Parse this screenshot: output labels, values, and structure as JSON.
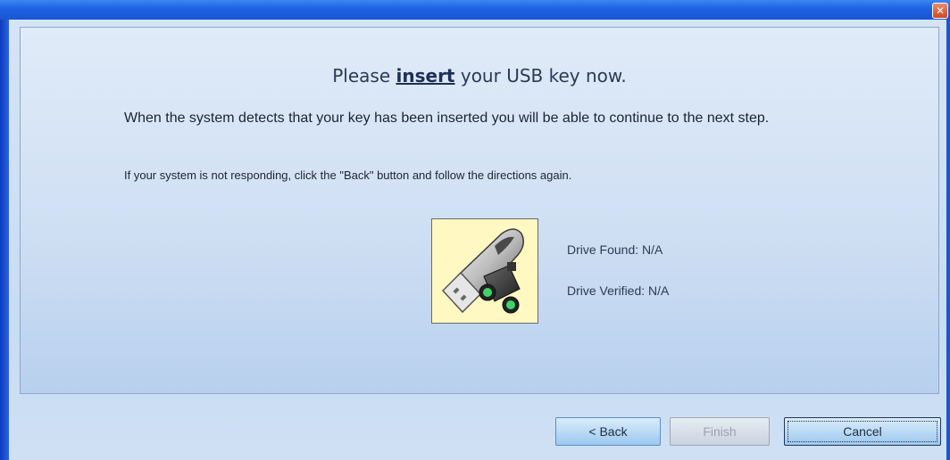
{
  "window": {
    "close_symbol": "✕"
  },
  "heading": {
    "before": "Please",
    "keyword": "insert",
    "after": "your USB key now."
  },
  "message": "When the system detects that your key has been inserted you will be able to continue to the next step.",
  "hint": "If your system is not responding, click the \"Back\" button and follow the directions again.",
  "status": {
    "drive_found": "Drive Found:  N/A",
    "drive_verified": "Drive Verified: N/A"
  },
  "buttons": {
    "back": "< Back",
    "finish": "Finish",
    "cancel": "Cancel"
  },
  "colors": {
    "frame": "#1c57d6",
    "panel_bg": "#cfdff3",
    "image_bg": "#fff8c2"
  },
  "icons": {
    "close": "close-icon",
    "usb": "usb-key-icon"
  }
}
